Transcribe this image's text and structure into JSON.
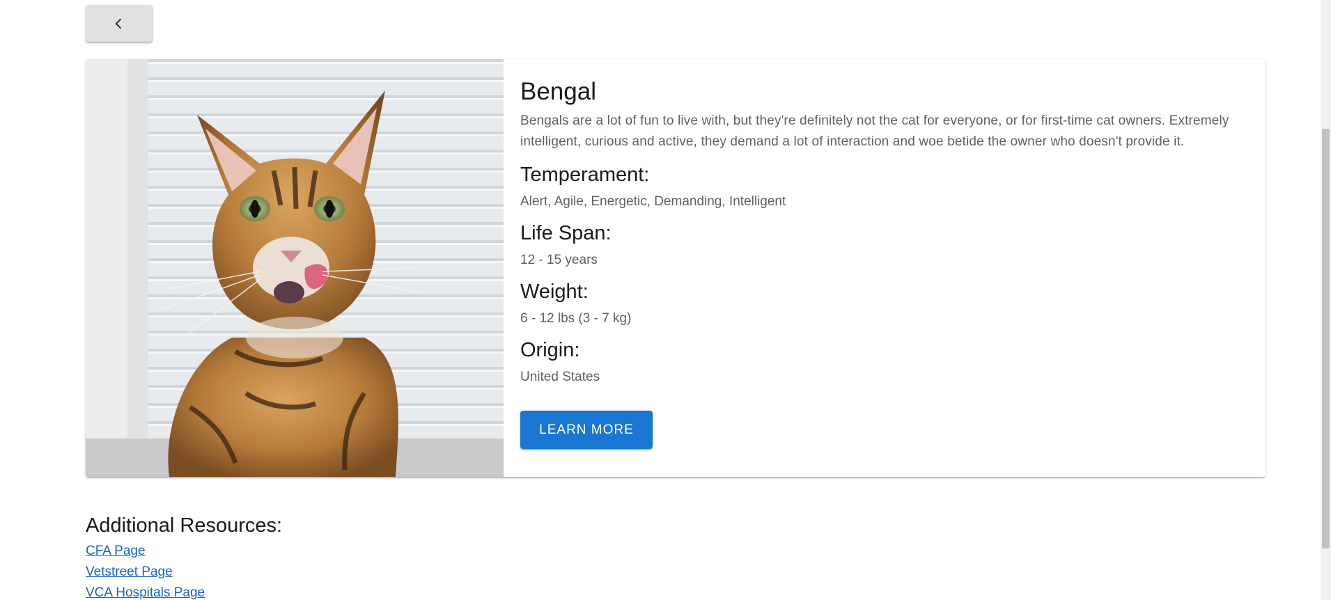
{
  "header": {
    "back_icon": "chevron-left-icon"
  },
  "breed": {
    "name": "Bengal",
    "description": "Bengals are a lot of fun to live with, but they're definitely not the cat for everyone, or for first-time cat owners. Extremely intelligent, curious and active, they demand a lot of interaction and woe betide the owner who doesn't provide it.",
    "image_alt": "Bengal cat photo",
    "fields": [
      {
        "label": "Temperament:",
        "value": "Alert, Agile, Energetic, Demanding, Intelligent"
      },
      {
        "label": "Life Span:",
        "value": "12 - 15 years"
      },
      {
        "label": "Weight:",
        "value": "6 - 12 lbs (3 - 7 kg)"
      },
      {
        "label": "Origin:",
        "value": "United States"
      }
    ],
    "learn_more_label": "LEARN MORE"
  },
  "resources": {
    "title": "Additional Resources:",
    "links": [
      {
        "label": "CFA Page"
      },
      {
        "label": "Vetstreet Page"
      },
      {
        "label": "VCA Hospitals Page"
      }
    ]
  },
  "colors": {
    "primary": "#1976d2",
    "link": "#1565c0",
    "back_button_bg": "#e0e0e0"
  }
}
